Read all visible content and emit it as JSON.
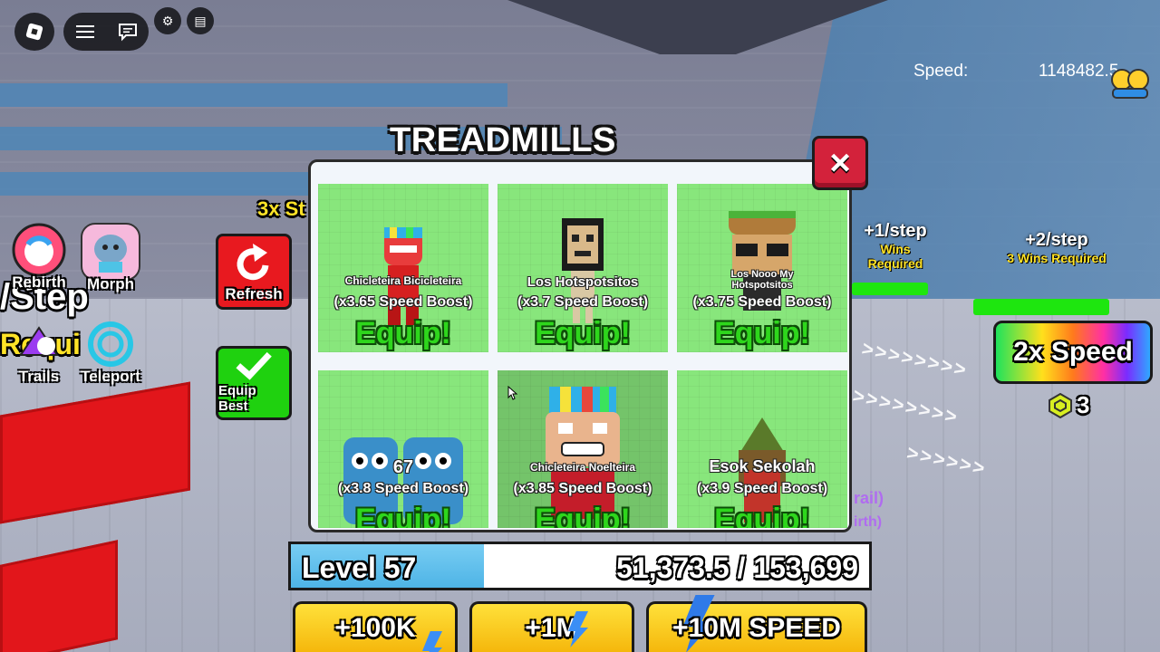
{
  "hud": {
    "speed_label": "Speed:",
    "speed_value": "1148482.5"
  },
  "left_menu": {
    "rebirth": "Rebirth",
    "morph": "Morph",
    "trails": "Trails",
    "teleport": "Teleport",
    "refresh": "Refresh",
    "equip_best": "Equip Best"
  },
  "world_signs": {
    "left_partial_1": "/Step",
    "left_partial_2": "Requi",
    "behind_panel": "3x St",
    "step1_title": "+1/step",
    "step1_req": "Wins Required",
    "step2_title": "+2/step",
    "step2_req": "3 Wins Required",
    "partial_trail": "rail)",
    "partial_birth": "irth)"
  },
  "speed_boost_offer": {
    "label": "2x Speed",
    "price": "3"
  },
  "panel": {
    "title": "TREADMILLS",
    "close_label": "×",
    "items": [
      {
        "name": "Chicleteira Bicicleteira",
        "boost": "(x3.65 Speed Boost)",
        "action": "Equip!"
      },
      {
        "name": "Los Hotspotsitos",
        "boost": "(x3.7 Speed Boost)",
        "action": "Equip!"
      },
      {
        "name": "Los Nooo My Hotspotsitos",
        "boost": "(x3.75 Speed Boost)",
        "action": "Equip!"
      },
      {
        "name": "67",
        "boost": "(x3.8 Speed Boost)",
        "action": "Equip!"
      },
      {
        "name": "Chicleteira Noelteira",
        "boost": "(x3.85 Speed Boost)",
        "action": "Equip!"
      },
      {
        "name": "Esok Sekolah",
        "boost": "(x3.9 Speed Boost)",
        "action": "Equip!"
      }
    ]
  },
  "level": {
    "label": "Level 57",
    "xp_text": "51,373.5 / 153,699",
    "progress_fraction": 0.334
  },
  "buy_buttons": {
    "b1": "+100K",
    "b2": "+1M",
    "b3": "+10M SPEED"
  },
  "colors": {
    "card_green": "#88e67c",
    "equip_green": "#2ed61c",
    "close_red": "#d3223b",
    "button_yellow": "#ffe13a",
    "level_blue": "#4eb4e6"
  }
}
